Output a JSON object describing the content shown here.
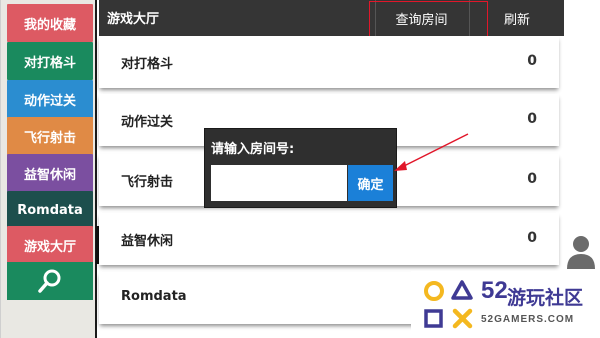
{
  "sidebar": {
    "items": [
      {
        "label": "我的收藏",
        "color": "#dd5a63"
      },
      {
        "label": "对打格斗",
        "color": "#1a8a5e"
      },
      {
        "label": "动作过关",
        "color": "#2b8dd0"
      },
      {
        "label": "飞行射击",
        "color": "#e08a45"
      },
      {
        "label": "益智休闲",
        "color": "#7b4fa0"
      },
      {
        "label": "Romdata",
        "color": "#1d4f4d"
      },
      {
        "label": "游戏大厅",
        "color": "#dd5a63"
      }
    ],
    "search_icon": "search-icon",
    "search_color": "#1a8a5e"
  },
  "header": {
    "title": "游戏大厅",
    "query_label": "查询房间",
    "refresh_label": "刷新"
  },
  "rows": [
    {
      "name": "对打格斗",
      "count": "0"
    },
    {
      "name": "动作过关",
      "count": "0"
    },
    {
      "name": "飞行射击",
      "count": "0"
    },
    {
      "name": "益智休闲",
      "count": "0"
    },
    {
      "name": "Romdata",
      "count": ""
    }
  ],
  "dialog": {
    "title": "请输入房间号:",
    "input_value": "",
    "confirm_label": "确定"
  },
  "watermark": {
    "number": "52",
    "name": "游玩社区",
    "domain": "52GAMERS.COM"
  },
  "colors": {
    "header_bg": "#353535",
    "accent_blue": "#1b80d8",
    "annotation_red": "#e1172a"
  }
}
